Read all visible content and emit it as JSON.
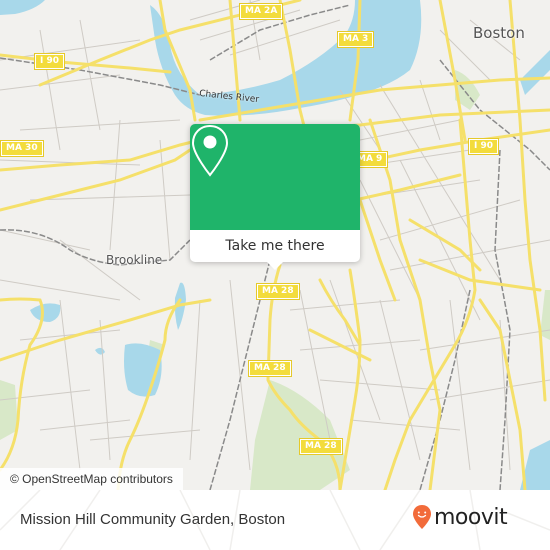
{
  "map": {
    "place_labels": {
      "boston": "Boston",
      "brookline": "Brookline",
      "charles_river": "Charles River"
    },
    "road_shields": {
      "ma2a": "MA 2A",
      "ma3": "MA 3",
      "i90_west": "I 90",
      "i90_east": "I 90",
      "ma30": "MA 30",
      "ma9": "MA 9",
      "ma28_a": "MA 28",
      "ma28_b": "MA 28",
      "ma28_c": "MA 28"
    },
    "attribution": "© OpenStreetMap contributors",
    "colors": {
      "land": "#f2f1ee",
      "water": "#a8d8ea",
      "park": "#d8e8c8",
      "major_road": "#f5e06a",
      "minor_road": "#c8c4be",
      "rail": "#888888"
    }
  },
  "popup": {
    "icon": "map-pin-icon",
    "cta_label": "Take me there",
    "accent_color": "#1fb46a"
  },
  "footer": {
    "place_name": "Mission Hill Community Garden, Boston",
    "brand": "moovit",
    "brand_icon": "moovit-pin-icon",
    "brand_color": "#f26b3a"
  }
}
